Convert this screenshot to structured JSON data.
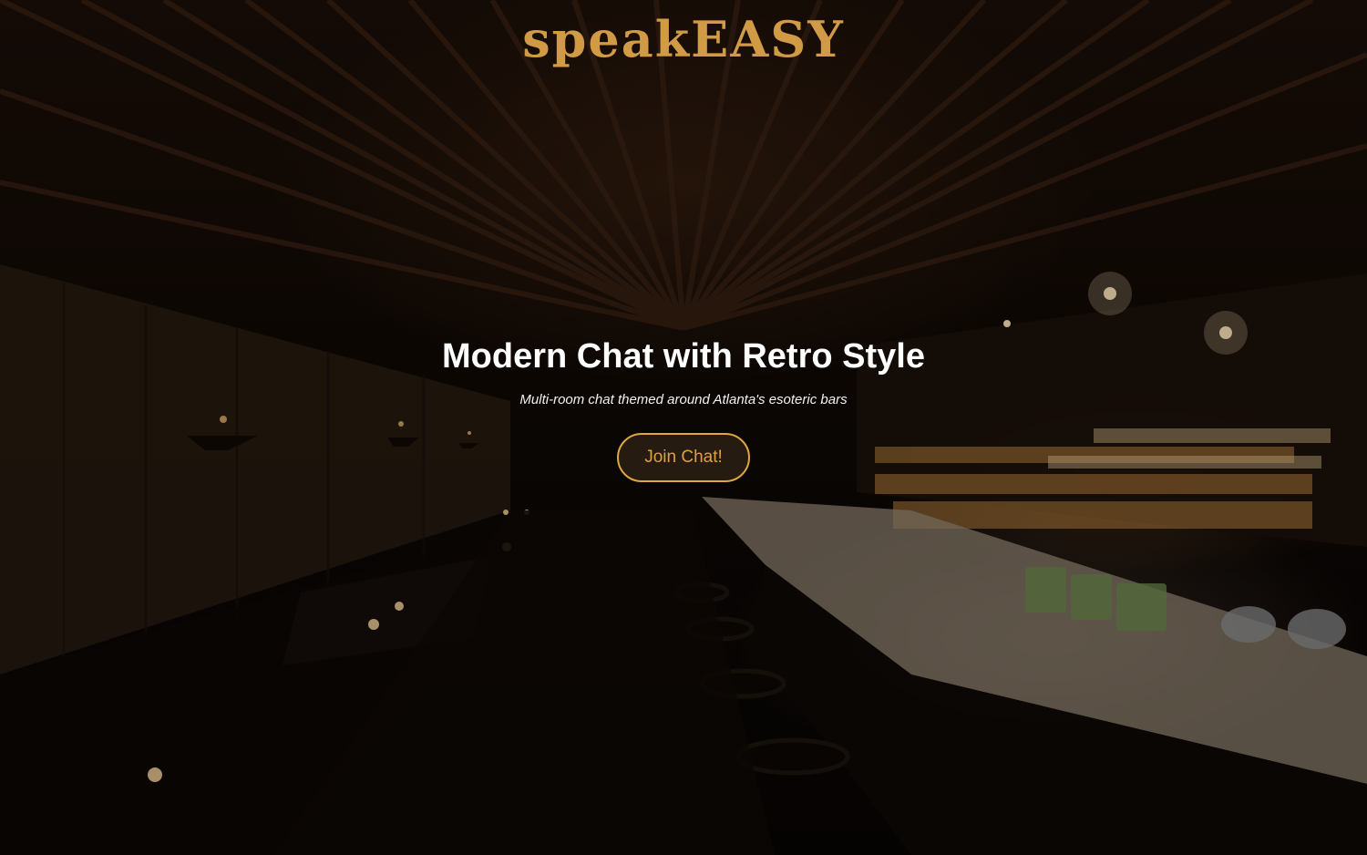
{
  "header": {
    "logo_text": "speakEASY"
  },
  "hero": {
    "headline": "Modern Chat with Retro Style",
    "tagline": "Multi-room chat themed around Atlanta's esoteric bars",
    "cta_label": "Join Chat!"
  },
  "colors": {
    "brand_gold": "#d19a45",
    "button_border": "#e0a63f",
    "headline": "#ffffff"
  }
}
